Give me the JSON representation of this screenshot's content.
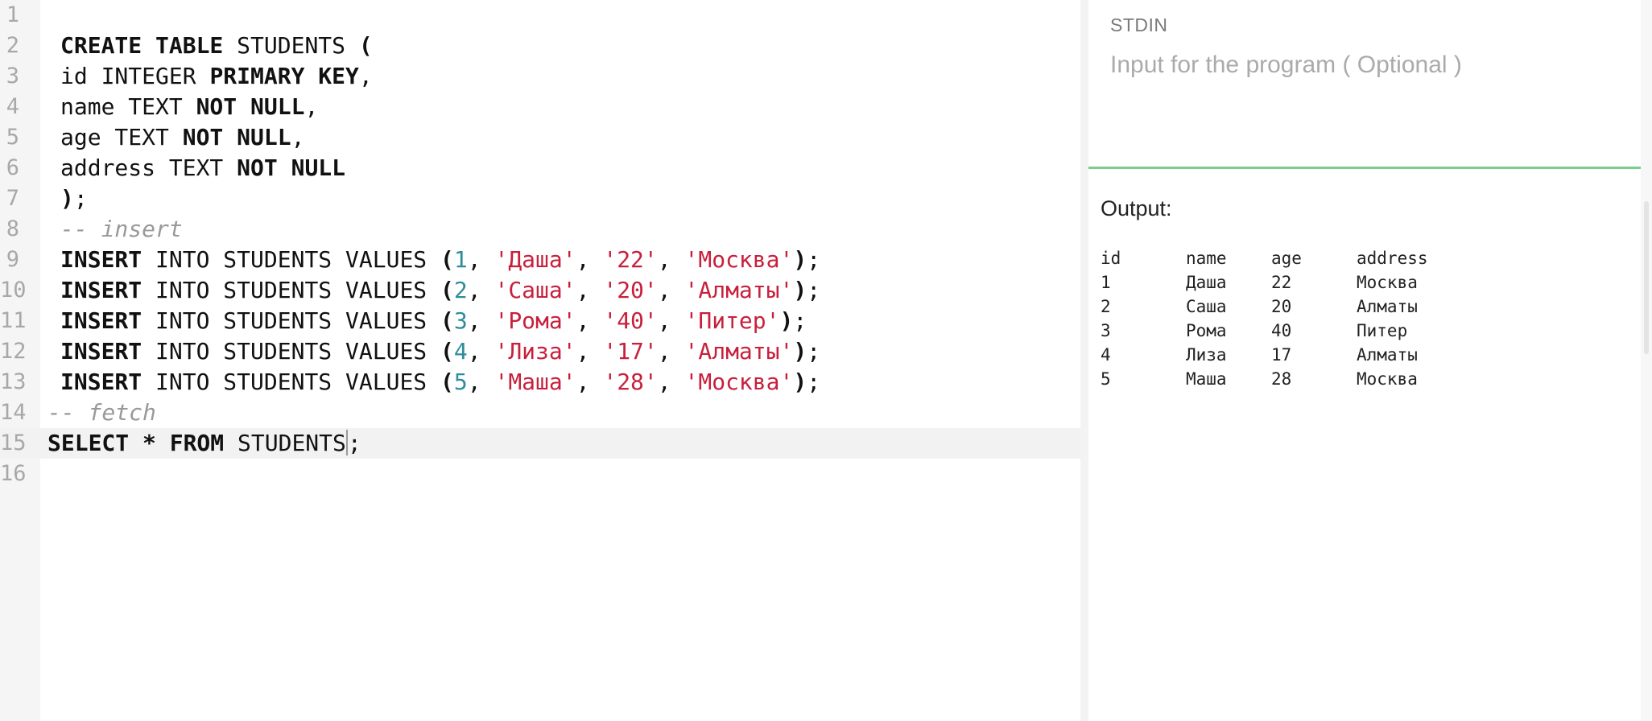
{
  "editor": {
    "lines": [
      {
        "num": "1",
        "tokens": []
      },
      {
        "num": "2",
        "tokens": [
          {
            "t": "CREATE TABLE",
            "k": "kw"
          },
          {
            "t": " STUDENTS ",
            "k": "plain"
          },
          {
            "t": "(",
            "k": "kw"
          }
        ]
      },
      {
        "num": "3",
        "tokens": [
          {
            "t": "id INTEGER ",
            "k": "plain"
          },
          {
            "t": "PRIMARY KEY",
            "k": "kw"
          },
          {
            "t": ",",
            "k": "plain"
          }
        ]
      },
      {
        "num": "4",
        "tokens": [
          {
            "t": "name TEXT ",
            "k": "plain"
          },
          {
            "t": "NOT NULL",
            "k": "kw"
          },
          {
            "t": ",",
            "k": "plain"
          }
        ]
      },
      {
        "num": "5",
        "tokens": [
          {
            "t": "age TEXT ",
            "k": "plain"
          },
          {
            "t": "NOT NULL",
            "k": "kw"
          },
          {
            "t": ",",
            "k": "plain"
          }
        ]
      },
      {
        "num": "6",
        "tokens": [
          {
            "t": "address TEXT ",
            "k": "plain"
          },
          {
            "t": "NOT NULL",
            "k": "kw"
          }
        ]
      },
      {
        "num": "7",
        "tokens": [
          {
            "t": ")",
            "k": "kw"
          },
          {
            "t": ";",
            "k": "plain"
          }
        ]
      },
      {
        "num": "8",
        "tokens": [
          {
            "t": "-- insert",
            "k": "cmt"
          }
        ]
      },
      {
        "num": "9",
        "tokens": [
          {
            "t": "INSERT",
            "k": "kw"
          },
          {
            "t": " INTO STUDENTS VALUES ",
            "k": "plain"
          },
          {
            "t": "(",
            "k": "kw"
          },
          {
            "t": "1",
            "k": "num"
          },
          {
            "t": ", ",
            "k": "plain"
          },
          {
            "t": "'Даша'",
            "k": "str"
          },
          {
            "t": ", ",
            "k": "plain"
          },
          {
            "t": "'22'",
            "k": "str"
          },
          {
            "t": ", ",
            "k": "plain"
          },
          {
            "t": "'Москва'",
            "k": "str"
          },
          {
            "t": ")",
            "k": "kw"
          },
          {
            "t": ";",
            "k": "plain"
          }
        ]
      },
      {
        "num": "10",
        "tokens": [
          {
            "t": "INSERT",
            "k": "kw"
          },
          {
            "t": " INTO STUDENTS VALUES ",
            "k": "plain"
          },
          {
            "t": "(",
            "k": "kw"
          },
          {
            "t": "2",
            "k": "num"
          },
          {
            "t": ", ",
            "k": "plain"
          },
          {
            "t": "'Саша'",
            "k": "str"
          },
          {
            "t": ", ",
            "k": "plain"
          },
          {
            "t": "'20'",
            "k": "str"
          },
          {
            "t": ", ",
            "k": "plain"
          },
          {
            "t": "'Алматы'",
            "k": "str"
          },
          {
            "t": ")",
            "k": "kw"
          },
          {
            "t": ";",
            "k": "plain"
          }
        ]
      },
      {
        "num": "11",
        "tokens": [
          {
            "t": "INSERT",
            "k": "kw"
          },
          {
            "t": " INTO STUDENTS VALUES ",
            "k": "plain"
          },
          {
            "t": "(",
            "k": "kw"
          },
          {
            "t": "3",
            "k": "num"
          },
          {
            "t": ", ",
            "k": "plain"
          },
          {
            "t": "'Рома'",
            "k": "str"
          },
          {
            "t": ", ",
            "k": "plain"
          },
          {
            "t": "'40'",
            "k": "str"
          },
          {
            "t": ", ",
            "k": "plain"
          },
          {
            "t": "'Питер'",
            "k": "str"
          },
          {
            "t": ")",
            "k": "kw"
          },
          {
            "t": ";",
            "k": "plain"
          }
        ]
      },
      {
        "num": "12",
        "tokens": [
          {
            "t": "INSERT",
            "k": "kw"
          },
          {
            "t": " INTO STUDENTS VALUES ",
            "k": "plain"
          },
          {
            "t": "(",
            "k": "kw"
          },
          {
            "t": "4",
            "k": "num"
          },
          {
            "t": ", ",
            "k": "plain"
          },
          {
            "t": "'Лиза'",
            "k": "str"
          },
          {
            "t": ", ",
            "k": "plain"
          },
          {
            "t": "'17'",
            "k": "str"
          },
          {
            "t": ", ",
            "k": "plain"
          },
          {
            "t": "'Алматы'",
            "k": "str"
          },
          {
            "t": ")",
            "k": "kw"
          },
          {
            "t": ";",
            "k": "plain"
          }
        ]
      },
      {
        "num": "13",
        "tokens": [
          {
            "t": "INSERT",
            "k": "kw"
          },
          {
            "t": " INTO STUDENTS VALUES ",
            "k": "plain"
          },
          {
            "t": "(",
            "k": "kw"
          },
          {
            "t": "5",
            "k": "num"
          },
          {
            "t": ", ",
            "k": "plain"
          },
          {
            "t": "'Маша'",
            "k": "str"
          },
          {
            "t": ", ",
            "k": "plain"
          },
          {
            "t": "'28'",
            "k": "str"
          },
          {
            "t": ", ",
            "k": "plain"
          },
          {
            "t": "'Москва'",
            "k": "str"
          },
          {
            "t": ")",
            "k": "kw"
          },
          {
            "t": ";",
            "k": "plain"
          }
        ]
      },
      {
        "num": "14",
        "outdent": true,
        "tokens": [
          {
            "t": "-- fetch",
            "k": "cmt"
          }
        ]
      },
      {
        "num": "15",
        "outdent": true,
        "active": true,
        "tokens": [
          {
            "t": "SELECT * FROM",
            "k": "kw"
          },
          {
            "t": " STUDENTS",
            "k": "plain"
          },
          {
            "t": "",
            "k": "cursor"
          },
          {
            "t": ";",
            "k": "plain"
          }
        ]
      },
      {
        "num": "16",
        "tokens": []
      }
    ]
  },
  "stdin": {
    "label": "STDIN",
    "placeholder": "Input for the program ( Optional )"
  },
  "output": {
    "label": "Output:",
    "headers": [
      "id",
      "name",
      "age",
      "address"
    ],
    "rows": [
      [
        "1",
        "Даша",
        "22",
        "Москва"
      ],
      [
        "2",
        "Саша",
        "20",
        "Алматы"
      ],
      [
        "3",
        "Рома",
        "40",
        "Питер"
      ],
      [
        "4",
        "Лиза",
        "17",
        "Алматы"
      ],
      [
        "5",
        "Маша",
        "28",
        "Москва"
      ]
    ]
  },
  "colors": {
    "keyword": "#111111",
    "number": "#2e8d9c",
    "string": "#c8203c",
    "comment": "#999999",
    "divider_accent": "#79cf8a"
  }
}
